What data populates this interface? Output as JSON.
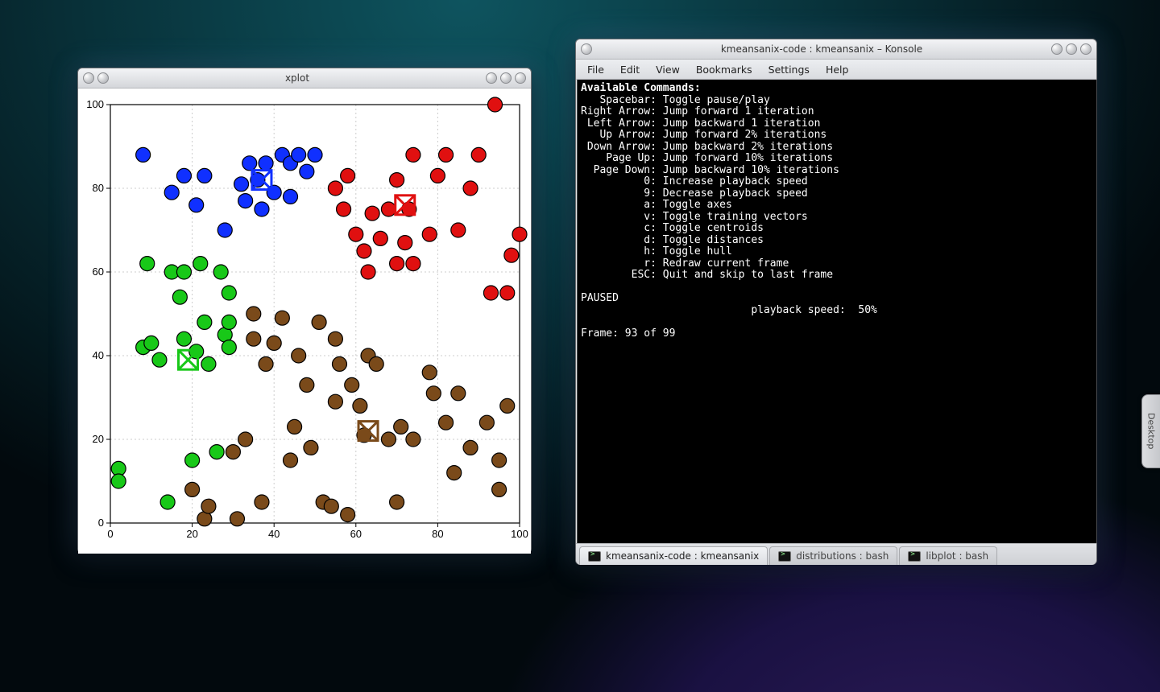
{
  "desktop": {
    "pager_label": "Desktop"
  },
  "xplot": {
    "window_title": "xplot"
  },
  "konsole": {
    "window_title": "kmeansanix-code : kmeansanix – Konsole",
    "menus": [
      "File",
      "Edit",
      "View",
      "Bookmarks",
      "Settings",
      "Help"
    ],
    "tabs": [
      {
        "label": "kmeansanix-code : kmeansanix",
        "active": true
      },
      {
        "label": "distributions : bash",
        "active": false
      },
      {
        "label": "libplot : bash",
        "active": false
      }
    ],
    "terminal": {
      "header": "Available Commands:",
      "commands": [
        {
          "key": "Spacebar",
          "desc": "Toggle pause/play"
        },
        {
          "key": "Right Arrow",
          "desc": "Jump forward 1 iteration"
        },
        {
          "key": "Left Arrow",
          "desc": "Jump backward 1 iteration"
        },
        {
          "key": "Up Arrow",
          "desc": "Jump forward 2% iterations"
        },
        {
          "key": "Down Arrow",
          "desc": "Jump backward 2% iterations"
        },
        {
          "key": "Page Up",
          "desc": "Jump forward 10% iterations"
        },
        {
          "key": "Page Down",
          "desc": "Jump backward 10% iterations"
        },
        {
          "key": "0",
          "desc": "Increase playback speed"
        },
        {
          "key": "9",
          "desc": "Decrease playback speed"
        },
        {
          "key": "a",
          "desc": "Toggle axes"
        },
        {
          "key": "v",
          "desc": "Toggle training vectors"
        },
        {
          "key": "c",
          "desc": "Toggle centroids"
        },
        {
          "key": "d",
          "desc": "Toggle distances"
        },
        {
          "key": "h",
          "desc": "Toggle hull"
        },
        {
          "key": "r",
          "desc": "Redraw current frame"
        },
        {
          "key": "ESC",
          "desc": "Quit and skip to last frame"
        }
      ],
      "status_paused": "PAUSED",
      "playback_label": "playback speed:",
      "playback_value": "50%",
      "frame_line": "Frame: 93 of 99"
    }
  },
  "chart_data": {
    "type": "scatter",
    "title": "",
    "xlabel": "",
    "ylabel": "",
    "xlim": [
      0,
      100
    ],
    "ylim": [
      0,
      100
    ],
    "xticks": [
      0,
      20,
      40,
      60,
      80,
      100
    ],
    "yticks": [
      0,
      20,
      40,
      60,
      80,
      100
    ],
    "grid": true,
    "colors": {
      "blue": "#1030ff",
      "red": "#e01010",
      "green": "#18c818",
      "brown": "#7a4a1a"
    },
    "series": [
      {
        "name": "blue",
        "points": [
          [
            8,
            88
          ],
          [
            15,
            79
          ],
          [
            18,
            83
          ],
          [
            21,
            76
          ],
          [
            23,
            83
          ],
          [
            28,
            70
          ],
          [
            32,
            81
          ],
          [
            33,
            77
          ],
          [
            34,
            86
          ],
          [
            36,
            82
          ],
          [
            37,
            75
          ],
          [
            38,
            86
          ],
          [
            40,
            79
          ],
          [
            42,
            88
          ],
          [
            44,
            78
          ],
          [
            44,
            86
          ],
          [
            46,
            88
          ],
          [
            48,
            84
          ],
          [
            50,
            88
          ]
        ]
      },
      {
        "name": "red",
        "points": [
          [
            55,
            80
          ],
          [
            57,
            75
          ],
          [
            58,
            83
          ],
          [
            60,
            69
          ],
          [
            62,
            65
          ],
          [
            63,
            60
          ],
          [
            64,
            74
          ],
          [
            66,
            68
          ],
          [
            68,
            75
          ],
          [
            70,
            62
          ],
          [
            70,
            82
          ],
          [
            72,
            67
          ],
          [
            73,
            75
          ],
          [
            74,
            62
          ],
          [
            74,
            88
          ],
          [
            78,
            69
          ],
          [
            80,
            83
          ],
          [
            82,
            88
          ],
          [
            85,
            70
          ],
          [
            88,
            80
          ],
          [
            90,
            88
          ],
          [
            93,
            55
          ],
          [
            94,
            100
          ],
          [
            97,
            55
          ],
          [
            98,
            64
          ],
          [
            100,
            69
          ]
        ]
      },
      {
        "name": "green",
        "points": [
          [
            2,
            13
          ],
          [
            2,
            10
          ],
          [
            8,
            42
          ],
          [
            9,
            62
          ],
          [
            10,
            43
          ],
          [
            12,
            39
          ],
          [
            14,
            5
          ],
          [
            15,
            60
          ],
          [
            17,
            54
          ],
          [
            18,
            44
          ],
          [
            18,
            60
          ],
          [
            20,
            15
          ],
          [
            21,
            41
          ],
          [
            22,
            62
          ],
          [
            23,
            48
          ],
          [
            24,
            38
          ],
          [
            26,
            17
          ],
          [
            27,
            60
          ],
          [
            28,
            45
          ],
          [
            29,
            42
          ],
          [
            29,
            48
          ],
          [
            29,
            55
          ]
        ]
      },
      {
        "name": "brown",
        "points": [
          [
            20,
            8
          ],
          [
            23,
            1
          ],
          [
            24,
            4
          ],
          [
            30,
            17
          ],
          [
            31,
            1
          ],
          [
            33,
            20
          ],
          [
            35,
            50
          ],
          [
            35,
            44
          ],
          [
            37,
            5
          ],
          [
            38,
            38
          ],
          [
            40,
            43
          ],
          [
            42,
            49
          ],
          [
            44,
            15
          ],
          [
            45,
            23
          ],
          [
            46,
            40
          ],
          [
            48,
            33
          ],
          [
            49,
            18
          ],
          [
            51,
            48
          ],
          [
            52,
            5
          ],
          [
            54,
            4
          ],
          [
            55,
            44
          ],
          [
            55,
            29
          ],
          [
            56,
            38
          ],
          [
            58,
            2
          ],
          [
            59,
            33
          ],
          [
            61,
            28
          ],
          [
            62,
            21
          ],
          [
            63,
            40
          ],
          [
            65,
            38
          ],
          [
            68,
            20
          ],
          [
            70,
            5
          ],
          [
            71,
            23
          ],
          [
            74,
            20
          ],
          [
            78,
            36
          ],
          [
            79,
            31
          ],
          [
            82,
            24
          ],
          [
            84,
            12
          ],
          [
            85,
            31
          ],
          [
            88,
            18
          ],
          [
            92,
            24
          ],
          [
            95,
            8
          ],
          [
            95,
            15
          ],
          [
            97,
            28
          ]
        ]
      }
    ],
    "centroids": [
      {
        "name": "blue",
        "x": 37,
        "y": 82
      },
      {
        "name": "red",
        "x": 72,
        "y": 76
      },
      {
        "name": "green",
        "x": 19,
        "y": 39
      },
      {
        "name": "brown",
        "x": 63,
        "y": 22
      }
    ]
  }
}
